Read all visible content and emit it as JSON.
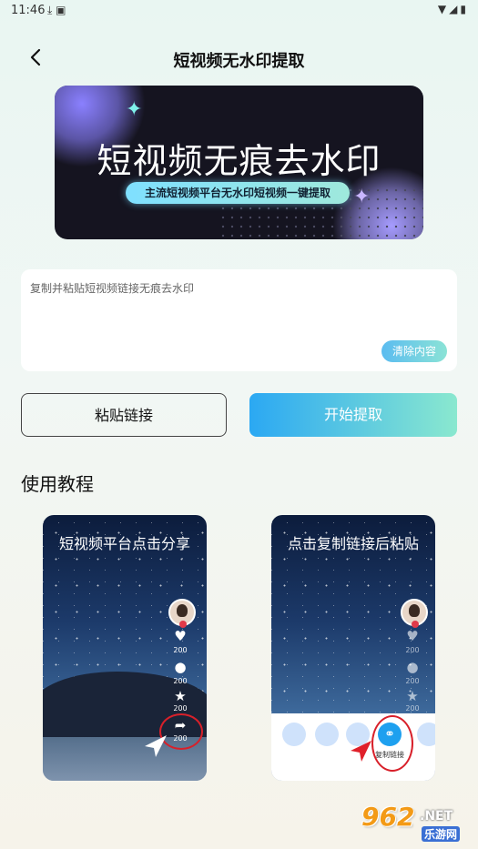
{
  "status_bar": {
    "time": "11:46",
    "notification_icons": [
      "download-icon",
      "image-icon"
    ],
    "right_icons": [
      "wifi-icon",
      "signal-icon",
      "battery-icon"
    ]
  },
  "header": {
    "title": "短视频无水印提取"
  },
  "banner": {
    "headline": "短视频无痕去水印",
    "tagline": "主流短视频平台无水印短视频一键提取"
  },
  "input": {
    "placeholder": "复制并粘贴短视频链接无痕去水印",
    "value": "",
    "clear_label": "清除内容"
  },
  "actions": {
    "paste_label": "粘贴链接",
    "start_label": "开始提取"
  },
  "tutorial": {
    "section_title": "使用教程",
    "steps": [
      {
        "title": "短视频平台点击分享",
        "counts": [
          "200",
          "200",
          "200",
          "200"
        ]
      },
      {
        "title": "点击复制链接后粘贴",
        "counts": [
          "200",
          "200",
          "200"
        ],
        "copy_link_label": "复制链接"
      }
    ]
  },
  "watermark": {
    "number": "962",
    "suffix": ".NET",
    "site": "乐游网"
  },
  "colors": {
    "accent_start": "#2ba8f3",
    "accent_end": "#8ae8cf",
    "highlight_ring": "#d8202a"
  }
}
